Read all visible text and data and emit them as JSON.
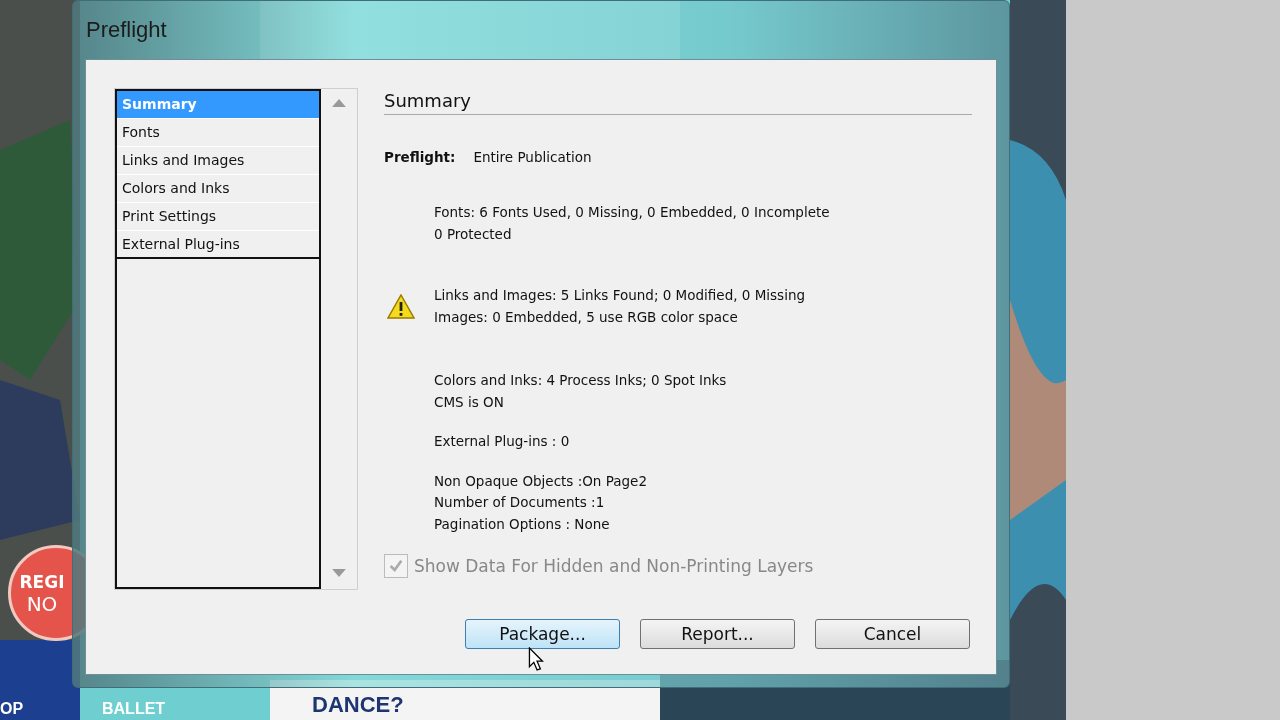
{
  "background": {
    "badge": [
      "REGI",
      "NO"
    ],
    "band": [
      "OP",
      "BALLET"
    ],
    "headline": "DANCE?"
  },
  "window": {
    "title": "Preflight"
  },
  "sidebar": {
    "items": [
      {
        "label": "Summary",
        "selected": true
      },
      {
        "label": "Fonts",
        "selected": false
      },
      {
        "label": "Links and Images",
        "selected": false
      },
      {
        "label": "Colors and Inks",
        "selected": false
      },
      {
        "label": "Print Settings",
        "selected": false
      },
      {
        "label": "External Plug-ins",
        "selected": false
      }
    ]
  },
  "summary": {
    "heading": "Summary",
    "scope_label": "Preflight:",
    "scope_value": "Entire Publication",
    "sections": [
      {
        "warning": false,
        "lines": [
          "Fonts: 6 Fonts Used, 0 Missing, 0 Embedded, 0 Incomplete",
          "0 Protected"
        ]
      },
      {
        "warning": true,
        "lines": [
          "Links and Images: 5 Links Found; 0 Modified, 0 Missing",
          "Images: 0 Embedded, 5 use RGB color space"
        ]
      },
      {
        "warning": false,
        "lines": [
          "Colors and Inks: 4 Process Inks; 0 Spot Inks",
          "CMS is ON"
        ]
      },
      {
        "warning": false,
        "lines": [
          "External Plug-ins : 0"
        ]
      },
      {
        "warning": false,
        "lines": [
          "Non Opaque Objects :On Page2",
          "Number of Documents :1",
          "Pagination Options : None"
        ]
      }
    ]
  },
  "option": {
    "label": "Show Data For Hidden and Non-Printing Layers",
    "checked": true,
    "disabled": true
  },
  "buttons": [
    {
      "label": "Package...",
      "default": true
    },
    {
      "label": "Report...",
      "default": false
    },
    {
      "label": "Cancel",
      "default": false
    }
  ]
}
